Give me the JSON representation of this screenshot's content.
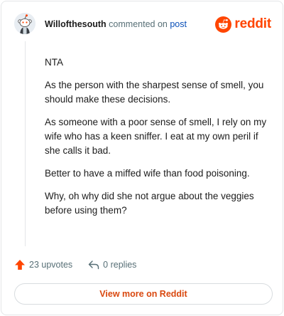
{
  "header": {
    "username": "Willofthesouth",
    "middle_text": " commented on ",
    "post_link": "post",
    "logo_text": "reddit"
  },
  "comment": {
    "paragraphs": [
      "NTA",
      "As the person with the sharpest sense of smell, you should make these decisions.",
      "As someone with a poor sense of smell, I rely on my wife who has a keen sniffer. I eat at my own peril if she calls it bad.",
      "Better to have a miffed wife than food poisoning.",
      "Why, oh why did she not argue about the veggies before using them?"
    ]
  },
  "actions": {
    "upvotes": "23 upvotes",
    "replies": "0 replies"
  },
  "view_more": "View more on Reddit",
  "colors": {
    "brand": "#ff4500",
    "upvote": "#ff4500",
    "link": "#0a4fb8",
    "button_text": "#d9480f"
  },
  "icons": {
    "avatar": "snoo-avatar-icon",
    "logo": "reddit-logo-icon",
    "upvote": "upvote-arrow-icon",
    "reply": "reply-arrow-icon"
  }
}
